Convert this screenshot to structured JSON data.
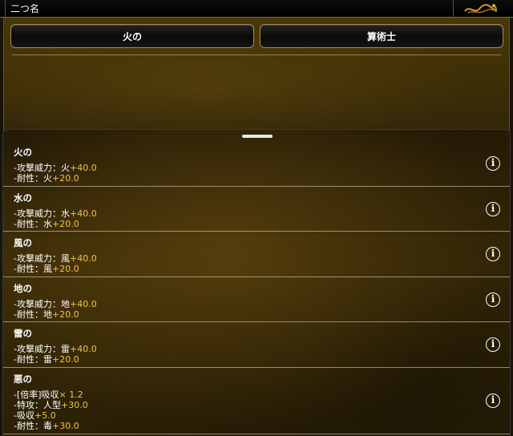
{
  "header": {
    "title": "二つ名"
  },
  "tabs": [
    {
      "label": "火の"
    },
    {
      "label": "算術士"
    }
  ],
  "items": [
    {
      "title": "火の",
      "lines": [
        {
          "text": "-攻撃威力：火",
          "value": "+40.0"
        },
        {
          "text": "-耐性：火",
          "value": "+20.0"
        }
      ]
    },
    {
      "title": "水の",
      "lines": [
        {
          "text": "-攻撃威力：水",
          "value": "+40.0"
        },
        {
          "text": "-耐性：水",
          "value": "+20.0"
        }
      ]
    },
    {
      "title": "風の",
      "lines": [
        {
          "text": "-攻撃威力：風",
          "value": "+40.0"
        },
        {
          "text": "-耐性：風",
          "value": "+20.0"
        }
      ]
    },
    {
      "title": "地の",
      "lines": [
        {
          "text": "-攻撃威力：地",
          "value": "+40.0"
        },
        {
          "text": "-耐性：地",
          "value": "+20.0"
        }
      ]
    },
    {
      "title": "雷の",
      "lines": [
        {
          "text": "-攻撃威力：雷",
          "value": "+40.0"
        },
        {
          "text": "-耐性：雷",
          "value": "+20.0"
        }
      ]
    },
    {
      "title": "悪の",
      "lines": [
        {
          "text": "-[倍率]吸収",
          "value": "× 1.2"
        },
        {
          "text": "-特攻：人型",
          "value": "+30.0"
        },
        {
          "text": "-吸収",
          "value": "+5.0"
        },
        {
          "text": "-耐性：毒",
          "value": "+30.0"
        }
      ]
    }
  ],
  "info_icon_glyph": "i",
  "colors": {
    "accent_gold": "#f0c24a",
    "border_gold": "#8a6a1e"
  }
}
